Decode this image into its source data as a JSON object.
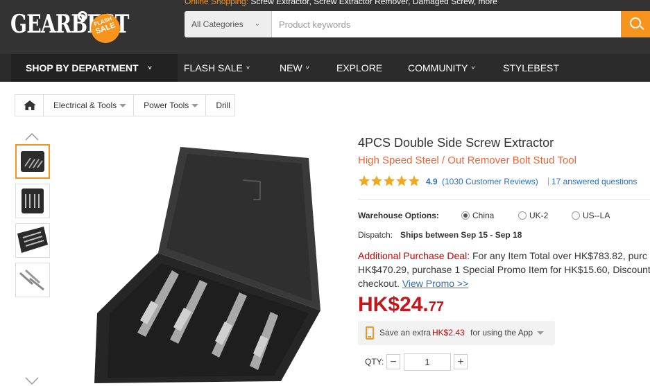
{
  "header": {
    "logo": "GEARBEST",
    "badge_top": "FLASH",
    "badge_bottom": "SALE",
    "promo_prefix": "Online Shopping:",
    "promo_suggestions": "Screw Extractor,  Screw Extractor Remover,  Damaged Screw,  more",
    "search": {
      "category": "All Categories",
      "placeholder": "Product keywords"
    }
  },
  "nav": {
    "department": "SHOP BY DEPARTMENT",
    "items": [
      {
        "label": "FLASH SALE"
      },
      {
        "label": "NEW"
      },
      {
        "label": "EXPLORE"
      },
      {
        "label": "COMMUNITY"
      },
      {
        "label": "STYLEBEST"
      }
    ]
  },
  "breadcrumb": [
    {
      "label": "Electrical & Tools"
    },
    {
      "label": "Power Tools"
    },
    {
      "label": "Drill"
    }
  ],
  "product": {
    "title": "4PCS Double Side Screw Extractor",
    "subtitle": "High Speed Steel / Out Remover Bolt Stud Tool",
    "rating": "4.9",
    "rating_fraction": 0.98,
    "reviews": "(1030 Customer Reviews)",
    "separator": "|",
    "questions": "17 answered questions",
    "warehouse_label": "Warehouse Options:",
    "warehouses": [
      {
        "label": "China",
        "checked": true
      },
      {
        "label": "UK-2",
        "checked": false
      },
      {
        "label": "US--LA",
        "checked": false
      }
    ],
    "dispatch_label": "Dispatch:",
    "dispatch_value": "Ships between Sep 15 - Sep 18",
    "deal_label": "Additional Purchase Deal:",
    "deal_line1": " For any Item Total over HK$783.82, purc",
    "deal_line2": "HK$470.29, purchase 1 Special Promo Item for HK$15.60, Discount",
    "deal_line3": "checkout. ",
    "deal_link": "View Promo >>",
    "price_main": "HK$24.",
    "price_cents": "77",
    "app_text": "Save an extra",
    "app_amount": "HK$2.43",
    "app_tail": "for using the App",
    "qty_label": "QTY:",
    "qty_minus": "−",
    "qty_plus": "+",
    "qty_value": "1"
  },
  "colors": {
    "accent": "#f7941d",
    "header_bg": "#333333",
    "price": "#c4161c",
    "link": "#2a6ebb",
    "subtitle": "#e8663d"
  }
}
